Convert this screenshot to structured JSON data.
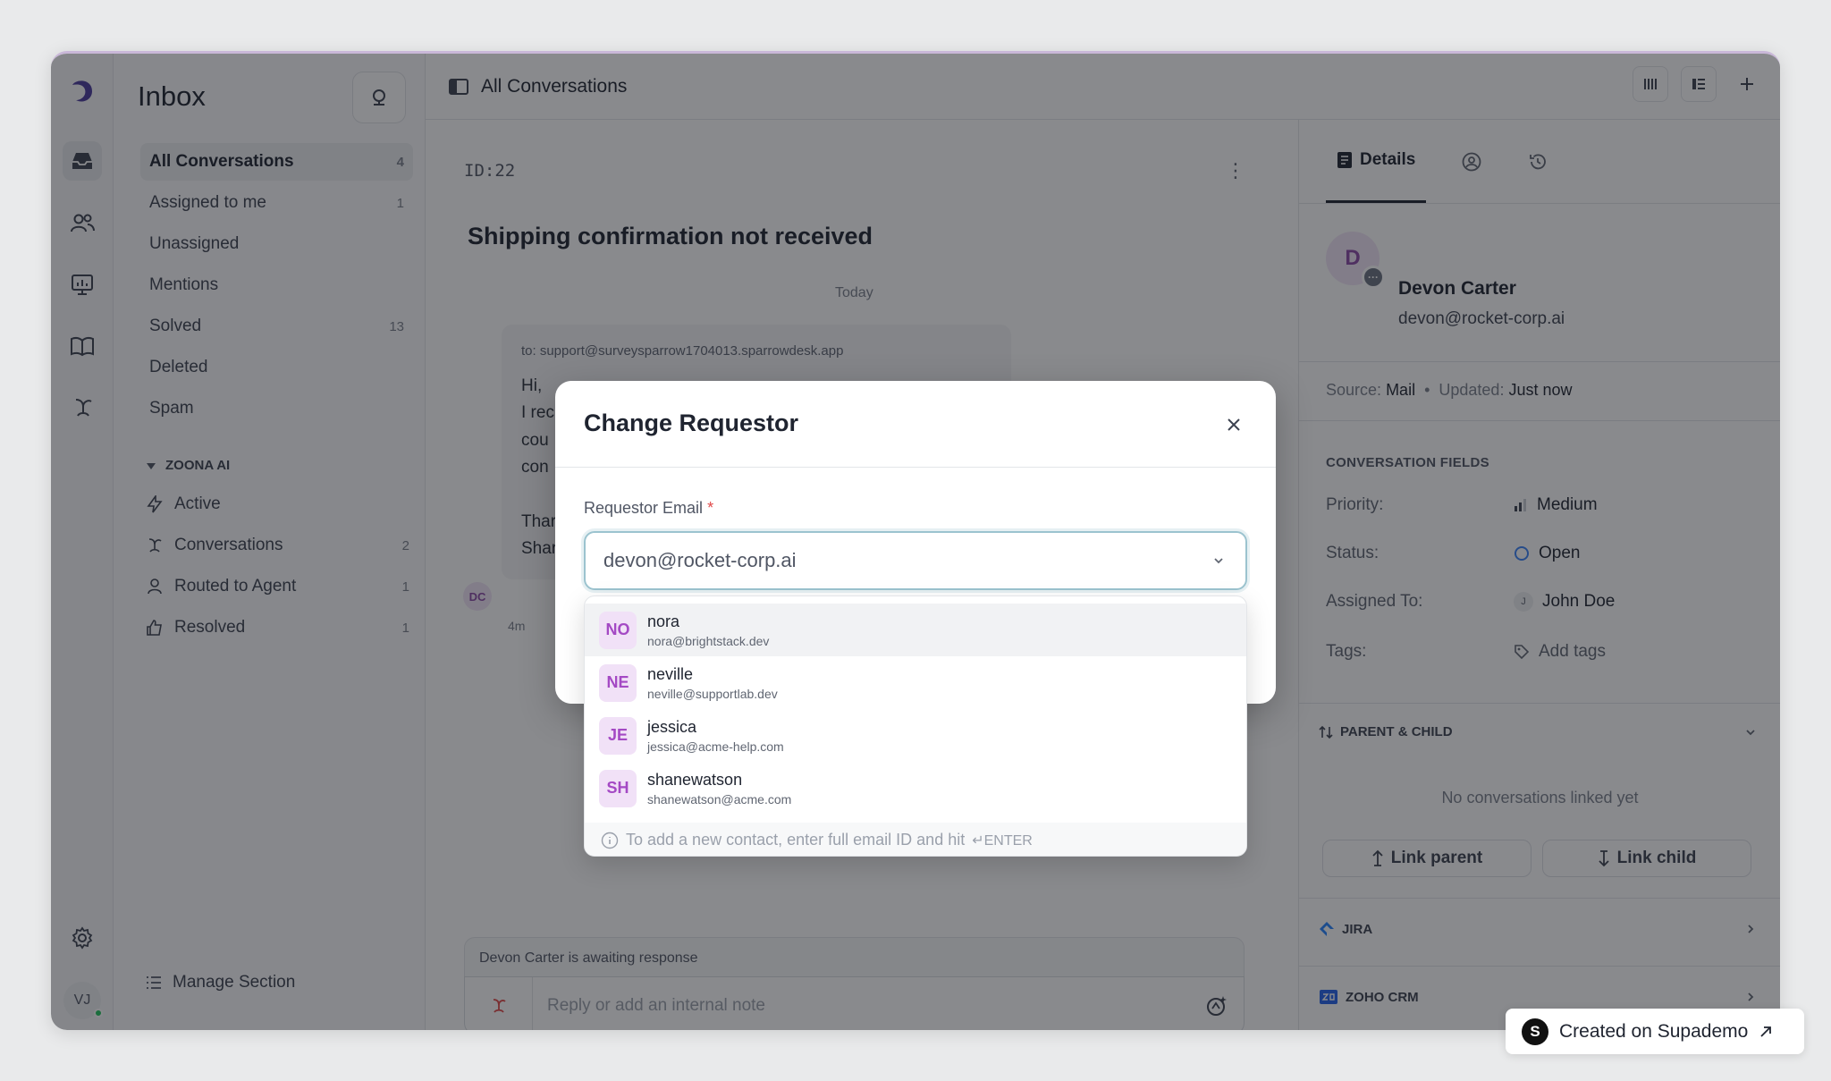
{
  "colors": {
    "accent": "#9bc3cf",
    "avatar_bg": "#f1e1f7",
    "avatar_text": "#a449c4",
    "required": "#e04848",
    "online": "#22c55e"
  },
  "rail": {
    "items": [
      {
        "icon": "logo-icon"
      },
      {
        "icon": "inbox-icon"
      },
      {
        "icon": "contacts-icon"
      },
      {
        "icon": "reports-icon"
      },
      {
        "icon": "knowledge-base-icon"
      },
      {
        "icon": "ai-agent-icon"
      },
      {
        "icon": "settings-icon"
      }
    ],
    "user_initials": "VJ"
  },
  "sidebar": {
    "title": "Inbox",
    "items": [
      {
        "label": "All Conversations",
        "count": "4"
      },
      {
        "label": "Assigned to me",
        "count": "1"
      },
      {
        "label": "Unassigned",
        "count": ""
      },
      {
        "label": "Mentions",
        "count": ""
      },
      {
        "label": "Solved",
        "count": "13"
      },
      {
        "label": "Deleted",
        "count": ""
      },
      {
        "label": "Spam",
        "count": ""
      }
    ],
    "ai_section": {
      "label": "ZOONA AI",
      "items": [
        {
          "label": "Active",
          "count": ""
        },
        {
          "label": "Conversations",
          "count": "2"
        },
        {
          "label": "Routed to Agent",
          "count": "1"
        },
        {
          "label": "Resolved",
          "count": "1"
        }
      ]
    },
    "manage_label": "Manage Section"
  },
  "topbar": {
    "title": "All Conversations"
  },
  "conversation": {
    "id": "ID:22",
    "subject": "Shipping confirmation not received",
    "date_divider": "Today",
    "message": {
      "to": "to: support@surveysparrow1704013.sparrowdesk.app",
      "lines": [
        "Hi,",
        "I rec",
        "cou",
        "con",
        "",
        "Thar",
        "Shar"
      ],
      "sender_initials": "DC",
      "time": "4m"
    },
    "awaiting": "Devon Carter is awaiting response",
    "reply_placeholder": "Reply or add an internal note"
  },
  "details": {
    "tab_active": "Details",
    "contact": {
      "initial": "D",
      "name": "Devon Carter",
      "email": "devon@rocket-corp.ai"
    },
    "source_label": "Source:",
    "source_value": "Mail",
    "updated_label": "Updated:",
    "updated_value": "Just now",
    "fields_title": "CONVERSATION FIELDS",
    "fields": {
      "priority_label": "Priority:",
      "priority_value": "Medium",
      "status_label": "Status:",
      "status_value": "Open",
      "assigned_label": "Assigned To:",
      "assigned_initial": "J",
      "assigned_value": "John Doe",
      "tags_label": "Tags:",
      "tags_value": "Add tags"
    },
    "parent_child": "PARENT & CHILD",
    "no_links": "No conversations linked yet",
    "link_parent": "Link parent",
    "link_child": "Link child",
    "jira": "JIRA",
    "zoho": "ZOHO CRM"
  },
  "modal": {
    "title": "Change Requestor",
    "field_label": "Requestor Email",
    "required_mark": "*",
    "selected_email": "devon@rocket-corp.ai",
    "options": [
      {
        "initials": "NO",
        "name": "nora",
        "email": "nora@brightstack.dev"
      },
      {
        "initials": "NE",
        "name": "neville",
        "email": "neville@supportlab.dev"
      },
      {
        "initials": "JE",
        "name": "jessica",
        "email": "jessica@acme-help.com"
      },
      {
        "initials": "SH",
        "name": "shanewatson",
        "email": "shanewatson@acme.com"
      }
    ],
    "hint": "To add a new contact, enter full email ID and hit",
    "hint_key": "↵ENTER"
  },
  "badge": {
    "label": "Created on Supademo",
    "logo": "S"
  }
}
